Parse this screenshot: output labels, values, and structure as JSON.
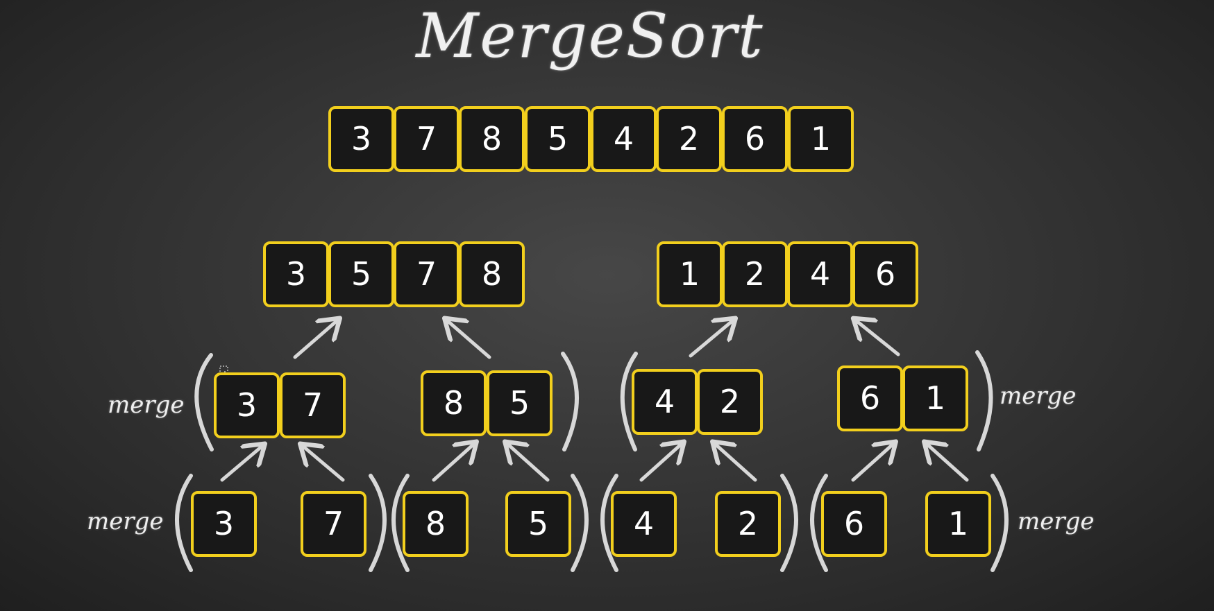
{
  "title": "MergeSort",
  "input_array": [
    "3",
    "7",
    "8",
    "5",
    "4",
    "2",
    "6",
    "1"
  ],
  "level1": {
    "left": [
      "3",
      "5",
      "7",
      "8"
    ],
    "right": [
      "1",
      "2",
      "4",
      "6"
    ]
  },
  "level2": {
    "pair1": [
      "3",
      "7"
    ],
    "pair2": [
      "8",
      "5"
    ],
    "pair3": [
      "4",
      "2"
    ],
    "pair4": [
      "6",
      "1"
    ]
  },
  "level3": [
    "3",
    "7",
    "8",
    "5",
    "4",
    "2",
    "6",
    "1"
  ],
  "labels": {
    "merge": "merge"
  },
  "colors": {
    "board": "#383838",
    "cell_border": "#f2cf1d",
    "cell_fill": "#181818",
    "chalk": "#e6e6e6"
  }
}
